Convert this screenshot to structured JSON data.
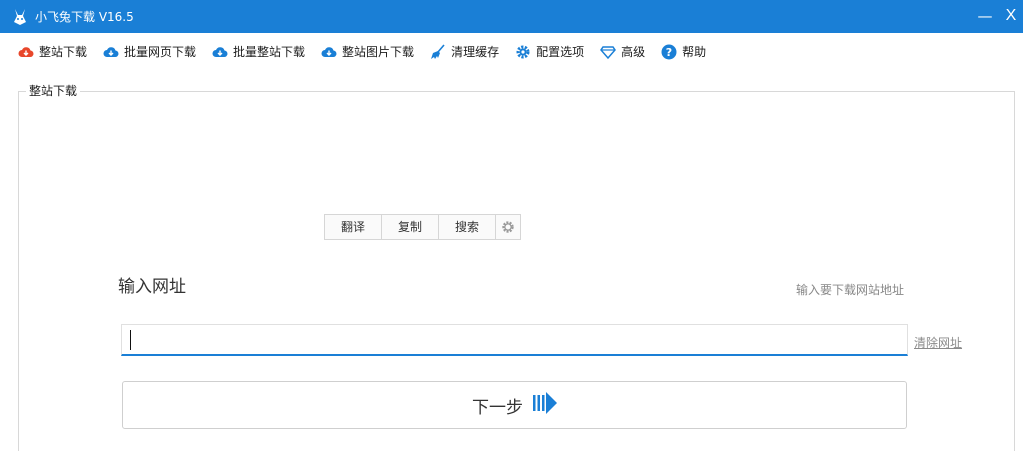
{
  "window": {
    "title": "小飞兔下载 V16.5",
    "minimize": "—",
    "close": "X"
  },
  "toolbar": {
    "items": [
      {
        "label": "整站下载",
        "icon": "cloud-download-red-icon"
      },
      {
        "label": "批量网页下载",
        "icon": "cloud-download-blue-icon"
      },
      {
        "label": "批量整站下载",
        "icon": "cloud-download-blue-icon"
      },
      {
        "label": "整站图片下载",
        "icon": "cloud-download-blue-icon"
      },
      {
        "label": "清理缓存",
        "icon": "broom-icon"
      },
      {
        "label": "配置选项",
        "icon": "gear-icon"
      },
      {
        "label": "高级",
        "icon": "diamond-icon"
      },
      {
        "label": "帮助",
        "icon": "help-icon"
      }
    ]
  },
  "group": {
    "label": "整站下载"
  },
  "minibar": {
    "translate": "翻译",
    "copy": "复制",
    "search": "搜索"
  },
  "url": {
    "label": "输入网址",
    "hint": "输入要下载网站地址",
    "value": "",
    "clear": "清除网址"
  },
  "next": {
    "label": "下一步"
  },
  "colors": {
    "accent": "#1a7fd6",
    "red": "#e8472b"
  }
}
